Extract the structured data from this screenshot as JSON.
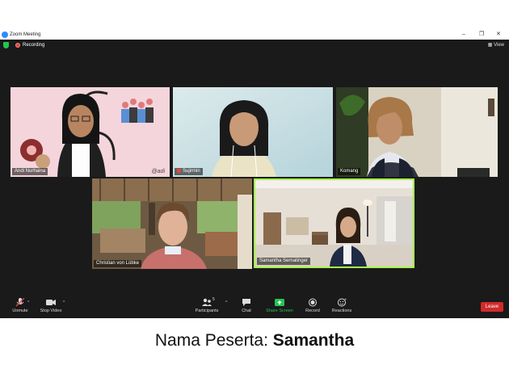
{
  "window": {
    "title": "Zoom Meeting",
    "controls": [
      "–",
      "❐",
      "✕"
    ]
  },
  "status": {
    "recording_label": "Recording",
    "view_label": "View"
  },
  "participants": [
    {
      "name": "Andi Nurhaina",
      "mic_muted": false
    },
    {
      "name": "Sujirmin",
      "mic_muted": true
    },
    {
      "name": "Komang",
      "mic_muted": false
    },
    {
      "name": "Christian von Lübke",
      "mic_muted": false
    },
    {
      "name": "Samantha Sernatinger",
      "mic_muted": false,
      "active_speaker": true
    }
  ],
  "tile_texts": {
    "signature": "@adi"
  },
  "toolbar": {
    "unmute": "Unmute",
    "stop_video": "Stop Video",
    "participants": "Participants",
    "participants_count": "5",
    "chat": "Chat",
    "share_screen": "Share Screen",
    "record": "Record",
    "reactions": "Reactions",
    "leave": "Leave"
  },
  "caption": {
    "prefix": "Nama Peserta:",
    "name": "Samantha"
  },
  "colors": {
    "accent_green": "#23c552",
    "leave_red": "#d12b2b",
    "active_border": "#a7ff4d"
  }
}
